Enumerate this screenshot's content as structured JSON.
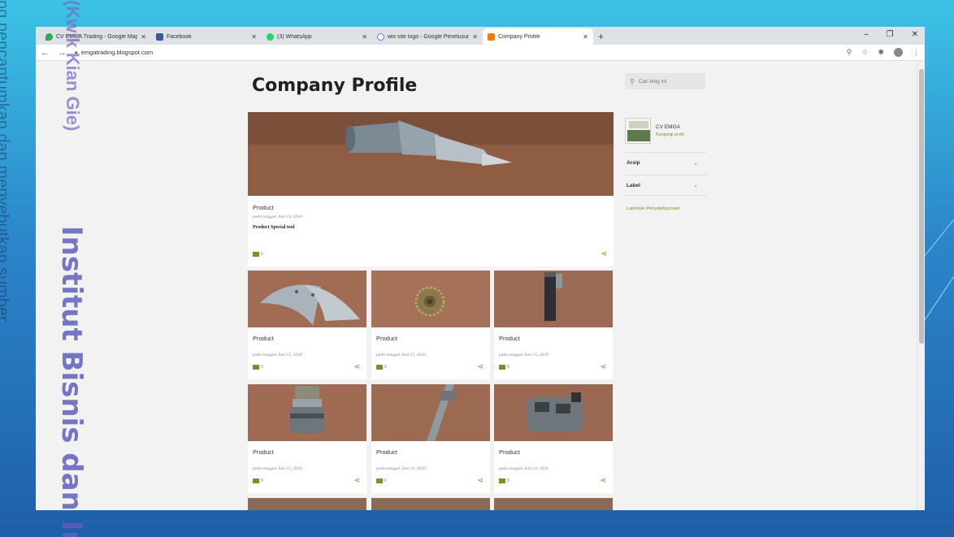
{
  "watermark": {
    "left_thin": "ng pencantumkan dan menyebutkan sumber",
    "kwik": "(Kwik Kian Gie)",
    "institut": "Institut Bisnis dan In"
  },
  "browser": {
    "tabs": [
      {
        "title": "CV EMGA Trading - Google Maps",
        "icon": "maps-pin-icon",
        "color": "#34a853"
      },
      {
        "title": "Facebook",
        "icon": "facebook-icon",
        "color": "#3b5998"
      },
      {
        "title": "(3) WhatsApp",
        "icon": "whatsapp-icon",
        "color": "#25d366"
      },
      {
        "title": "wix site logo - Google Penelusuran",
        "icon": "google-icon",
        "color": "#4285f4"
      },
      {
        "title": "Company Profile",
        "icon": "blogger-icon",
        "color": "#f57c00"
      }
    ],
    "url": "emgatrading.blogspot.com"
  },
  "blog": {
    "title": "Company Profile",
    "search_placeholder": "Cari blog ini",
    "featured": {
      "title": "Product",
      "date": "pada tanggal Juni 14, 2020",
      "snippet": "Product Special tool",
      "comments": "0"
    },
    "cards": [
      {
        "title": "Product",
        "date": "pada tanggal Juni 15, 2020",
        "comments": "0"
      },
      {
        "title": "Product",
        "date": "pada tanggal Juni 15, 2020",
        "comments": "0"
      },
      {
        "title": "Product",
        "date": "pada tanggal Juni 15, 2020",
        "comments": "0"
      },
      {
        "title": "Product",
        "date": "pada tanggal Juni 15, 2020",
        "comments": "0"
      },
      {
        "title": "Product",
        "date": "pada tanggal Juni 14, 2020",
        "comments": "0"
      },
      {
        "title": "Product",
        "date": "pada tanggal Juni 14, 2020",
        "comments": "0"
      }
    ],
    "sidebar": {
      "profile_name": "CV EMGA",
      "profile_link": "Kunjungi profil",
      "archive_label": "Arsip",
      "label_label": "Label",
      "report_link": "Laporkan Penyalahgunaan"
    }
  },
  "colors": {
    "accent": "#6a9a1f",
    "slide_top": "#3cc3e6",
    "slide_bottom": "#1f5fa8"
  }
}
